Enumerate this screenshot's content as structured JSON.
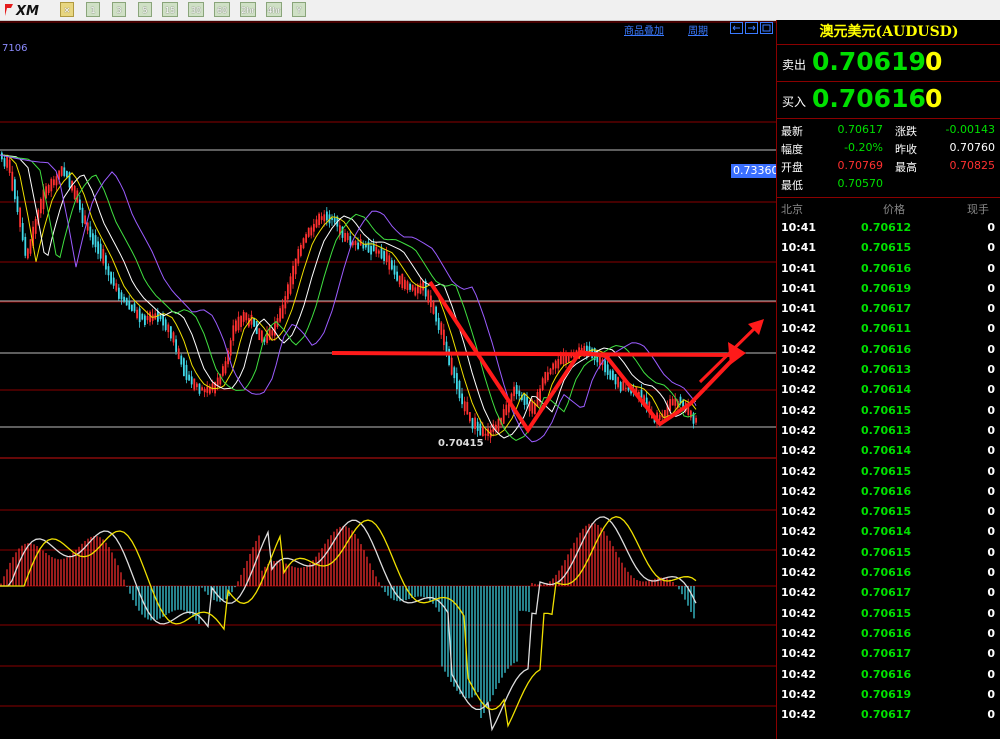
{
  "toolbar": {
    "logo_text": "XM",
    "buttons": [
      "✕",
      "1",
      "3",
      "5",
      "15",
      "30",
      "60",
      "2hr",
      "4hr",
      "Y"
    ]
  },
  "chart": {
    "indicator_label": "7106",
    "price_tag": "0.73360",
    "low_label": "0.70415",
    "links": {
      "overlay": "商品叠加",
      "period": "周期"
    }
  },
  "panel": {
    "title": "澳元美元(AUDUSD)",
    "sell": {
      "label": "卖出",
      "price": "0.70619",
      "size": "0"
    },
    "buy": {
      "label": "买入",
      "price": "0.70616",
      "size": "0"
    },
    "stats": [
      {
        "l1": "最新",
        "v1": "0.70617",
        "c1": "#00e000",
        "l2": "涨跌",
        "v2": "-0.00143",
        "c2": "#00e000"
      },
      {
        "l1": "幅度",
        "v1": "-0.20%",
        "c1": "#00e000",
        "l2": "昨收",
        "v2": "0.70760",
        "c2": "#ffffff"
      },
      {
        "l1": "开盘",
        "v1": "0.70769",
        "c1": "#ff3030",
        "l2": "最高",
        "v2": "0.70825",
        "c2": "#ff3030"
      },
      {
        "l1": "最低",
        "v1": "0.70570",
        "c1": "#00e000"
      }
    ],
    "tick_headers": {
      "time": "北京",
      "price": "价格",
      "vol": "现手"
    },
    "ticks": [
      {
        "t": "10:41",
        "p": "0.70612",
        "v": "0"
      },
      {
        "t": "10:41",
        "p": "0.70615",
        "v": "0"
      },
      {
        "t": "10:41",
        "p": "0.70616",
        "v": "0"
      },
      {
        "t": "10:41",
        "p": "0.70619",
        "v": "0"
      },
      {
        "t": "10:41",
        "p": "0.70617",
        "v": "0"
      },
      {
        "t": "10:42",
        "p": "0.70611",
        "v": "0"
      },
      {
        "t": "10:42",
        "p": "0.70616",
        "v": "0"
      },
      {
        "t": "10:42",
        "p": "0.70613",
        "v": "0"
      },
      {
        "t": "10:42",
        "p": "0.70614",
        "v": "0"
      },
      {
        "t": "10:42",
        "p": "0.70615",
        "v": "0"
      },
      {
        "t": "10:42",
        "p": "0.70613",
        "v": "0"
      },
      {
        "t": "10:42",
        "p": "0.70614",
        "v": "0"
      },
      {
        "t": "10:42",
        "p": "0.70615",
        "v": "0"
      },
      {
        "t": "10:42",
        "p": "0.70616",
        "v": "0"
      },
      {
        "t": "10:42",
        "p": "0.70615",
        "v": "0"
      },
      {
        "t": "10:42",
        "p": "0.70614",
        "v": "0"
      },
      {
        "t": "10:42",
        "p": "0.70615",
        "v": "0"
      },
      {
        "t": "10:42",
        "p": "0.70616",
        "v": "0"
      },
      {
        "t": "10:42",
        "p": "0.70617",
        "v": "0"
      },
      {
        "t": "10:42",
        "p": "0.70615",
        "v": "0"
      },
      {
        "t": "10:42",
        "p": "0.70616",
        "v": "0"
      },
      {
        "t": "10:42",
        "p": "0.70617",
        "v": "0"
      },
      {
        "t": "10:42",
        "p": "0.70616",
        "v": "0"
      },
      {
        "t": "10:42",
        "p": "0.70619",
        "v": "0"
      },
      {
        "t": "10:42",
        "p": "0.70617",
        "v": "0"
      }
    ]
  },
  "colors": {
    "up": "#ff3030",
    "down": "#40d8e8",
    "grid": "#8a0000",
    "price": "#00e000",
    "accent": "#ffff00"
  }
}
